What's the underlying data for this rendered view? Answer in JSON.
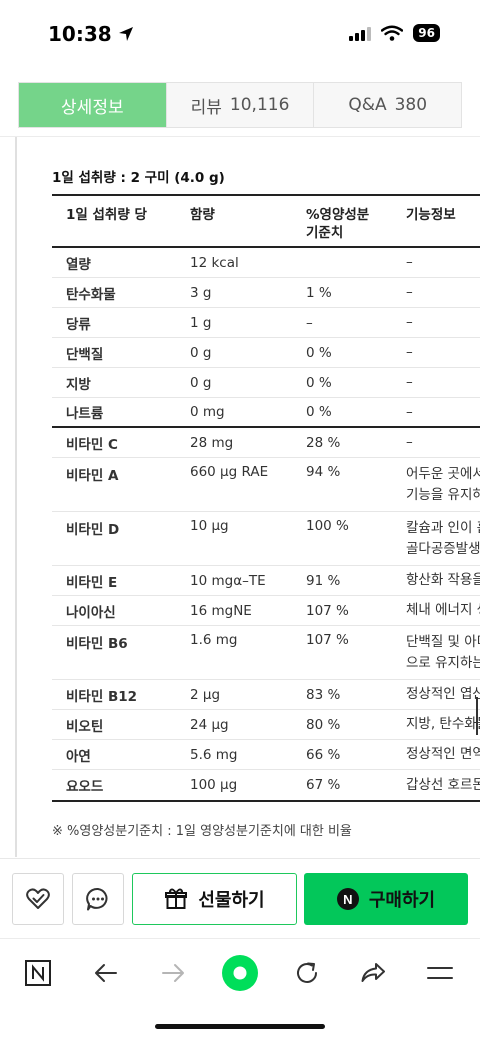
{
  "status_bar": {
    "time": "10:38",
    "battery": "96"
  },
  "tabs": [
    {
      "label": "상세정보",
      "count": ""
    },
    {
      "label": "리뷰",
      "count": "10,116"
    },
    {
      "label": "Q&A",
      "count": "380"
    }
  ],
  "nutrition": {
    "serving": "1일 섭취량 : 2 구미 (4.0 g)",
    "headers": {
      "item": "1일 섭취량 당",
      "amount": "함량",
      "daily_value_1": "%영양성분",
      "daily_value_2": "기준치",
      "function": "기능정보"
    },
    "rows": [
      {
        "name": "열량",
        "amount": "12 kcal",
        "dv": "",
        "func": "–"
      },
      {
        "name": "탄수화물",
        "amount": "3 g",
        "dv": "1 %",
        "func": "–"
      },
      {
        "name": "당류",
        "amount": "1 g",
        "dv": "–",
        "func": "–"
      },
      {
        "name": "단백질",
        "amount": "0 g",
        "dv": "0 %",
        "func": "–"
      },
      {
        "name": "지방",
        "amount": "0 g",
        "dv": "0 %",
        "func": "–"
      },
      {
        "name": "나트륨",
        "amount": "0 mg",
        "dv": "0 %",
        "func": "–"
      },
      {
        "name": "비타민 C",
        "amount": "28 mg",
        "dv": "28 %",
        "func": "–"
      },
      {
        "name": "비타민 A",
        "amount": "660 μg RAE",
        "dv": "94 %",
        "func": "어두운 곳에서",
        "func2": "기능을 유지하"
      },
      {
        "name": "비타민 D",
        "amount": "10 μg",
        "dv": "100 %",
        "func": "칼슘과 인이 흡",
        "func2": "골다공증발생"
      },
      {
        "name": "비타민 E",
        "amount": "10 mgα–TE",
        "dv": "91 %",
        "func": "항산화 작용을"
      },
      {
        "name": "나이아신",
        "amount": "16 mgNE",
        "dv": "107 %",
        "func": "체내 에너지 생"
      },
      {
        "name": "비타민 B6",
        "amount": "1.6 mg",
        "dv": "107 %",
        "func": "단백질 및 아미",
        "func2": "으로 유지하는"
      },
      {
        "name": "비타민 B12",
        "amount": "2 μg",
        "dv": "83 %",
        "func": "정상적인 엽산"
      },
      {
        "name": "비오틴",
        "amount": "24 μg",
        "dv": "80 %",
        "func": "지방, 탄수화물"
      },
      {
        "name": "아연",
        "amount": "5.6 mg",
        "dv": "66 %",
        "func": "정상적인 면역"
      },
      {
        "name": "요오드",
        "amount": "100 μg",
        "dv": "67 %",
        "func": "갑상선 호르몬"
      }
    ],
    "footnote": "※ %영양성분기준치 : 1일 영양성분기준치에 대한 비율"
  },
  "actions": {
    "gift_label": "선물하기",
    "buy_label": "구매하기",
    "buy_badge": "N"
  },
  "colors": {
    "tab_active": "#75d48a",
    "buy_green": "#03c75a",
    "home_green": "#00de5a"
  }
}
